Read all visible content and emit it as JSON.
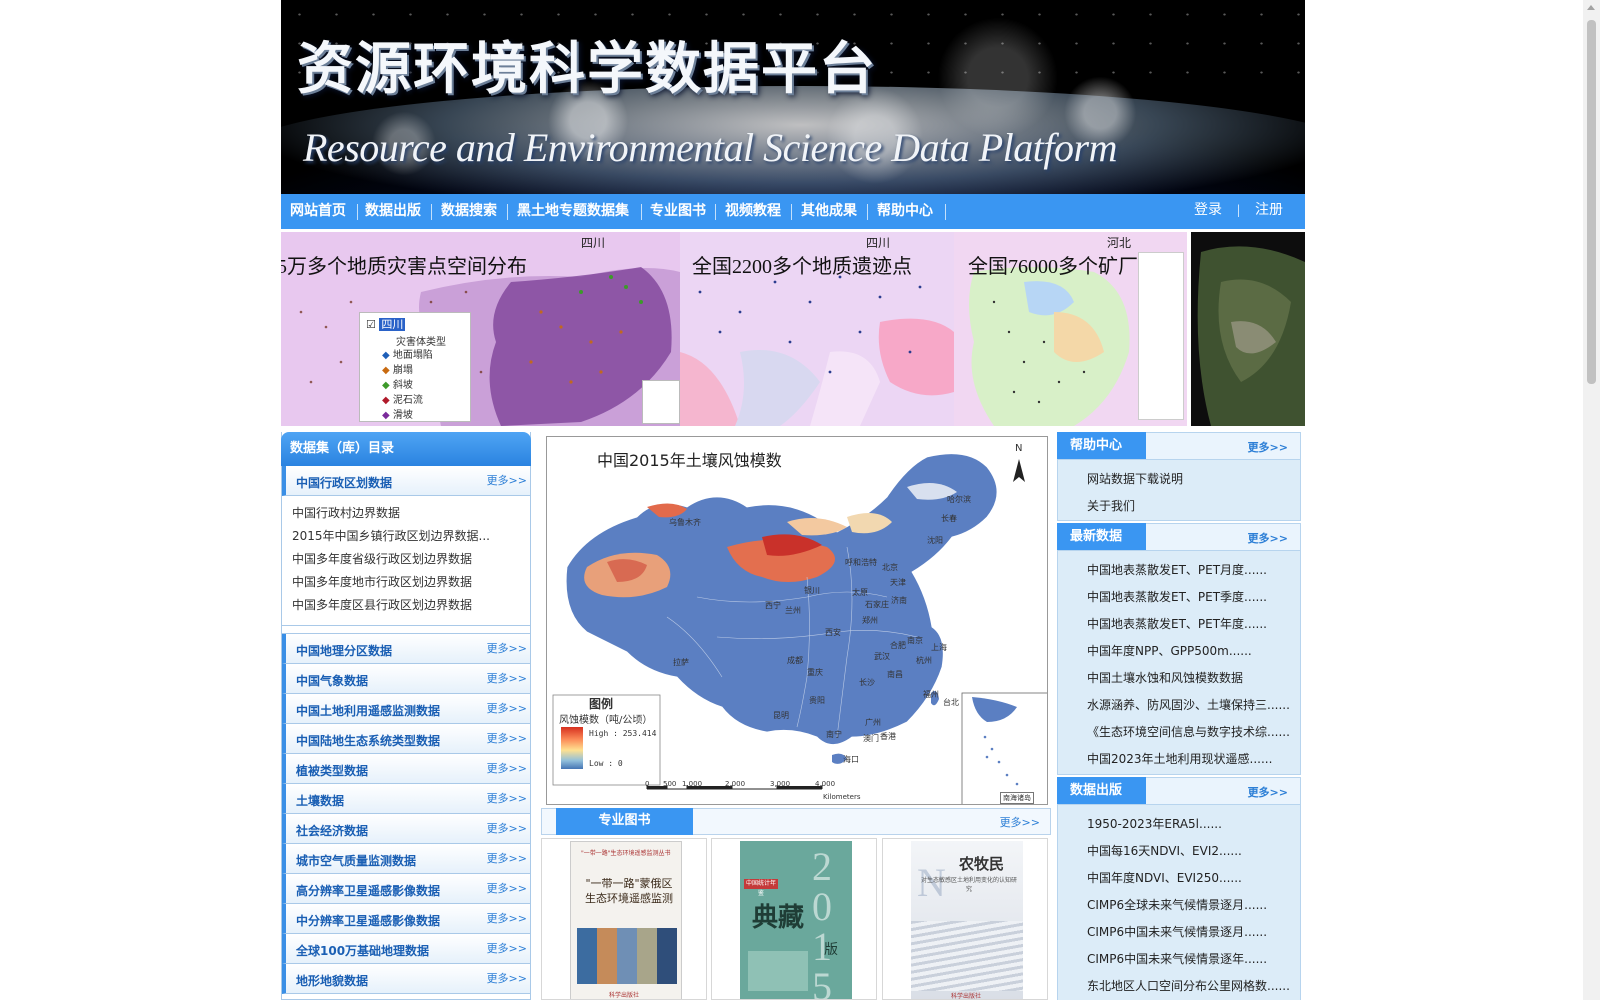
{
  "header": {
    "title_cn": "资源环境科学数据平台",
    "title_en": "Resource and Environmental Science Data Platform"
  },
  "nav": {
    "items": [
      "网站首页",
      "数据出版",
      "数据搜索",
      "黑土地专题数据集",
      "专业图书",
      "视频教程",
      "其他成果",
      "帮助中心"
    ],
    "login": "登录",
    "divider": "|",
    "register": "注册"
  },
  "slides": [
    {
      "province": "四川",
      "caption": "5万多个地质灾害点空间分布",
      "legend": {
        "selected": "四川",
        "title": "灾害体类型",
        "items": [
          "地面塌陷",
          "崩塌",
          "斜坡",
          "泥石流",
          "滑坡"
        ]
      }
    },
    {
      "province": "四川",
      "caption": "全国2200多个地质遗迹点"
    },
    {
      "province": "河北",
      "caption": "全国76000多个矿厂"
    },
    {
      "province": "",
      "caption": ""
    }
  ],
  "catalog": {
    "title": "数据集（库）目录",
    "more": "更多>>",
    "first": {
      "label": "中国行政区划数据",
      "items": [
        "中国行政村边界数据",
        "2015年中国乡镇行政区划边界数据...",
        "中国多年度省级行政区划边界数据",
        "中国多年度地市行政区划边界数据",
        "中国多年度区县行政区划边界数据"
      ]
    },
    "rows": [
      "中国地理分区数据",
      "中国气象数据",
      "中国土地利用遥感监测数据",
      "中国陆地生态系统类型数据",
      "植被类型数据",
      "土壤数据",
      "社会经济数据",
      "城市空气质量监测数据",
      "高分辨率卫星遥感影像数据",
      "中分辨率卫星遥感影像数据",
      "全球100万基础地理数据",
      "地形地貌数据"
    ]
  },
  "map": {
    "title": "中国2015年土壤风蚀模数",
    "north": "N",
    "legend_title": "图例",
    "legend_subtitle": "风蚀模数（吨/公顷）",
    "legend_high": "High : 253.414",
    "legend_low": "Low : 0",
    "scale_ticks": [
      "0",
      "500",
      "1,000",
      "2,000",
      "3,000",
      "4,000"
    ],
    "scale_unit": "Kilometers",
    "inset_label": "南海诸岛",
    "cities": [
      "乌鲁木齐",
      "哈尔滨",
      "长春",
      "沈阳",
      "呼和浩特",
      "北京",
      "天津",
      "银川",
      "太原",
      "石家庄",
      "济南",
      "西宁",
      "兰州",
      "郑州",
      "西安",
      "合肥",
      "南京",
      "上海",
      "武汉",
      "杭州",
      "拉萨",
      "成都",
      "重庆",
      "长沙",
      "南昌",
      "福州",
      "台北",
      "贵阳",
      "昆明",
      "南宁",
      "广州",
      "澳门",
      "香港",
      "海口"
    ]
  },
  "books": {
    "tab": "专业图书",
    "more": "更多>>",
    "items": [
      {
        "series": "\"一带一路\"生态环境遥感监测丛书",
        "title": "\"一带一路\"蒙俄区\n生态环境遥感监测",
        "publisher": "科学出版社"
      },
      {
        "tag": "中国统计年鉴",
        "title": "典藏",
        "year": "2015",
        "edition": "版"
      },
      {
        "title": "农牧民",
        "subtitle": "对生态敏感区土地利用变化的认知研究",
        "publisher": "科学出版社"
      }
    ]
  },
  "help": {
    "tab": "帮助中心",
    "more": "更多>>",
    "items": [
      "网站数据下载说明",
      "关于我们"
    ]
  },
  "latest": {
    "tab": "最新数据",
    "more": "更多>>",
    "items": [
      "中国地表蒸散发ET、PET月度......",
      "中国地表蒸散发ET、PET季度......",
      "中国地表蒸散发ET、PET年度......",
      "中国年度NPP、GPP500m......",
      "中国土壤水蚀和风蚀模数数据",
      "水源涵养、防风固沙、土壤保持三......",
      "《生态环境空间信息与数字技术综......",
      "中国2023年土地利用现状遥感......"
    ]
  },
  "publish": {
    "tab": "数据出版",
    "more": "更多>>",
    "items": [
      "1950-2023年ERA5l......",
      "中国每16天NDVI、EVI2......",
      "中国年度NDVI、EVI250......",
      "CIMP6全球未来气候情景逐月......",
      "CIMP6中国未来气候情景逐月......",
      "CIMP6中国未来气候情景逐年......",
      "东北地区人口空间分布公里网格数......"
    ]
  },
  "colors": {
    "nav_blue": "#3a96f2",
    "link_blue": "#1a5fb4",
    "panel_bg": "#dcecf8"
  }
}
